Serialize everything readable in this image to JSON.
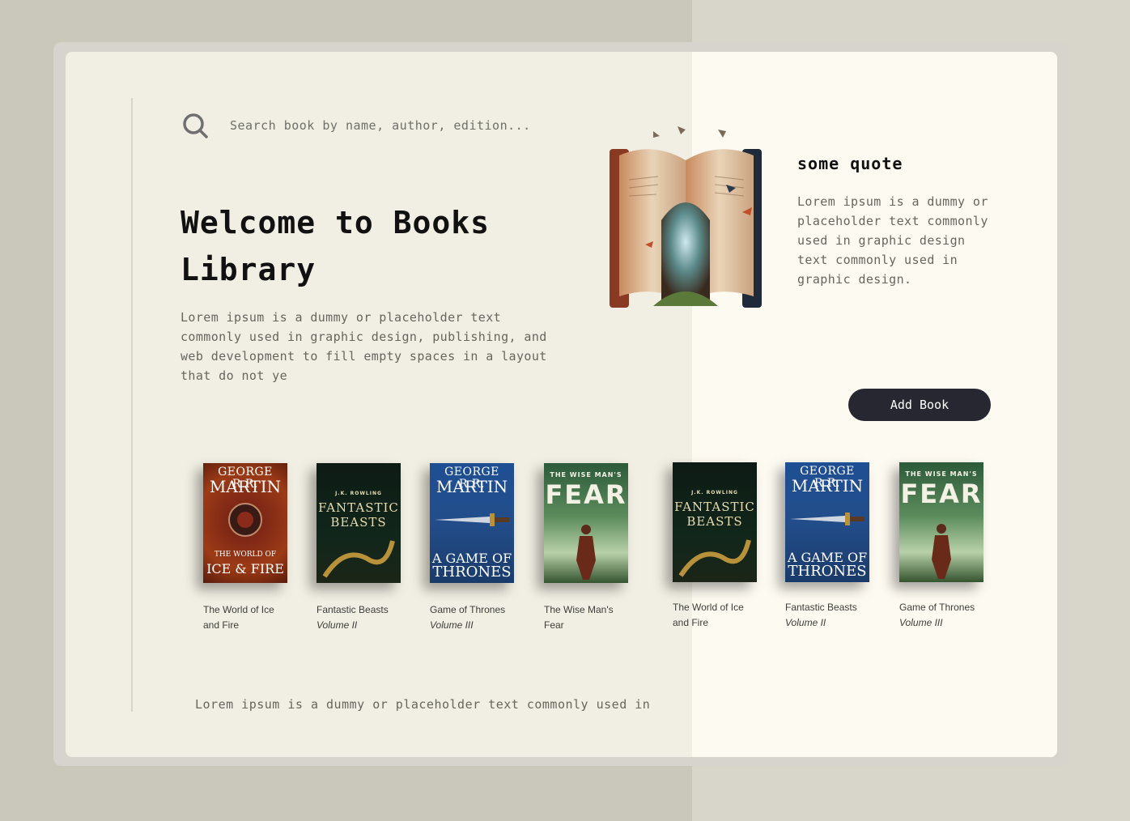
{
  "search": {
    "placeholder": "Search book by name, author, edition..."
  },
  "hero": {
    "title": "Welcome to Books Library",
    "description": "Lorem ipsum is a dummy or placeholder text commonly used in graphic design, publishing, and web development to fill empty spaces in a layout that do not ye"
  },
  "quote": {
    "title": "some quote",
    "text": "Lorem ipsum is a dummy or placeholder text commonly used in graphic design text commonly used in graphic design."
  },
  "actions": {
    "add_book": "Add Book"
  },
  "books": [
    {
      "cover": {
        "author_top": "GEORGE R.R.",
        "author_bottom": "MARTIN",
        "title_top": "THE WORLD OF",
        "title_bottom": "ICE & FIRE"
      },
      "title": "The World of Ice and Fire",
      "subtitle": ""
    },
    {
      "cover": {
        "author_top": "J.K. ROWLING",
        "author_bottom": "",
        "title_top": "FANTASTIC",
        "title_bottom": "BEASTS"
      },
      "title": "Fantastic Beasts",
      "subtitle": "Volume II"
    },
    {
      "cover": {
        "author_top": "GEORGE R.R.",
        "author_bottom": "MARTIN",
        "title_top": "A GAME OF",
        "title_bottom": "THRONES"
      },
      "title": "Game of Thrones",
      "subtitle": "Volume III"
    },
    {
      "cover": {
        "author_top": "THE WISE MAN'S",
        "author_bottom": "FEAR",
        "title_top": "",
        "title_bottom": ""
      },
      "title": "The Wise Man's Fear",
      "subtitle": ""
    },
    {
      "cover": {
        "author_top": "J.K. ROWLING",
        "author_bottom": "",
        "title_top": "FANTASTIC",
        "title_bottom": "BEASTS"
      },
      "title": "The World of Ice and Fire",
      "subtitle": ""
    },
    {
      "cover": {
        "author_top": "GEORGE R.R.",
        "author_bottom": "MARTIN",
        "title_top": "A GAME OF",
        "title_bottom": "THRONES"
      },
      "title": "Fantastic Beasts",
      "subtitle": "Volume II"
    },
    {
      "cover": {
        "author_top": "THE WISE MAN'S",
        "author_bottom": "FEAR",
        "title_top": "",
        "title_bottom": ""
      },
      "title": "Game of Thrones",
      "subtitle": "Volume III"
    }
  ],
  "footer": {
    "text": "Lorem ipsum is a dummy or placeholder text commonly used in"
  }
}
